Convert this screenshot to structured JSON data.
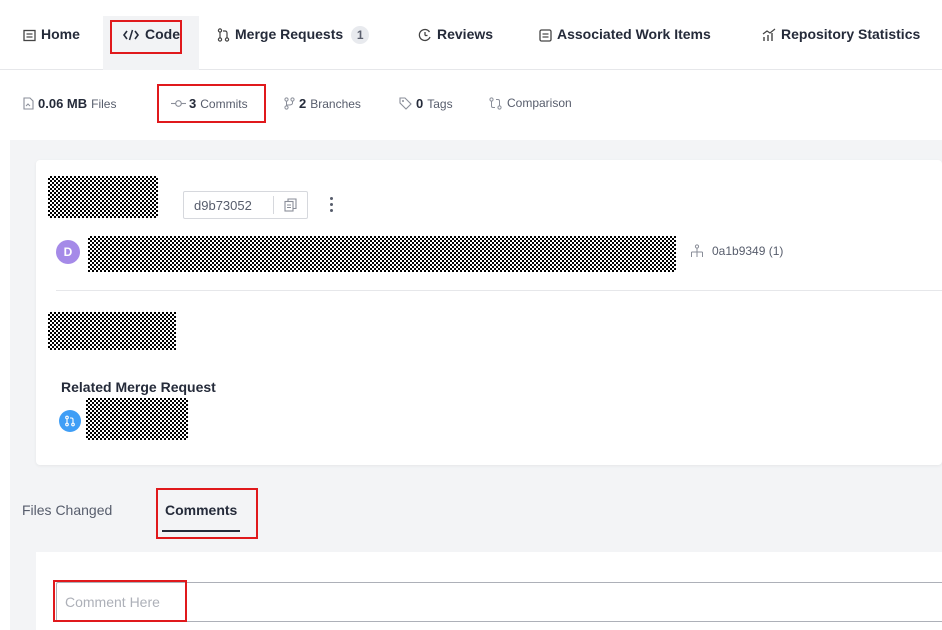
{
  "nav": {
    "home": "Home",
    "code": "Code",
    "merge_requests": "Merge Requests",
    "merge_requests_count": "1",
    "reviews": "Reviews",
    "work_items": "Associated Work Items",
    "repo_stats": "Repository Statistics"
  },
  "stats": {
    "size_value": "0.06 MB",
    "size_label": "Files",
    "commits_value": "3",
    "commits_label": "Commits",
    "branches_value": "2",
    "branches_label": "Branches",
    "tags_value": "0",
    "tags_label": "Tags",
    "comparison_label": "Comparison"
  },
  "commit": {
    "short_hash": "d9b73052",
    "avatar_initial": "D",
    "parent_ref": "0a1b9349 (1)",
    "related_mr_title": "Related Merge Request"
  },
  "tabs": {
    "files_changed": "Files Changed",
    "comments": "Comments"
  },
  "comment": {
    "placeholder": "Comment Here"
  },
  "colors": {
    "highlight_box": "#e0191c",
    "avatar": "#a58ae8",
    "mr_icon": "#3f9ef6"
  }
}
